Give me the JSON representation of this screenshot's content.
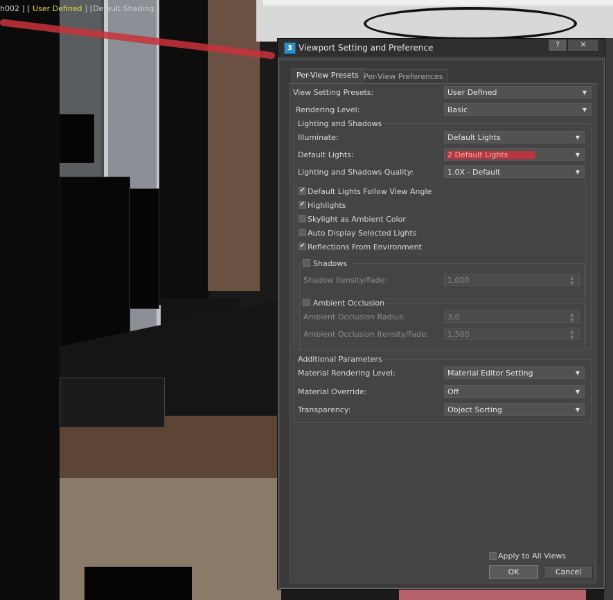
{
  "viewport": {
    "label_prefix": "h002 ] [ ",
    "label_highlight": "User Defined",
    "label_suffix": " ] [Default Shading ]"
  },
  "dialog": {
    "app_icon": "3",
    "title": "Viewport Setting and Preference",
    "help_button": "?",
    "close_button": "✕",
    "tabs": [
      "Per-View Presets",
      "Per-View Preferences"
    ],
    "view_setting_presets": {
      "label": "View Setting Presets:",
      "value": "User Defined"
    },
    "rendering_level": {
      "label": "Rendering Level:",
      "value": "Basic"
    },
    "lighting_group": {
      "title": "Lighting and Shadows",
      "illuminate": {
        "label": "Illuminate:",
        "value": "Default Lights"
      },
      "default_lights": {
        "label": "Default Lights:",
        "value": "2 Default Lights"
      },
      "quality": {
        "label": "Lighting and Shadows Quality:",
        "value": "1.0X - Default"
      },
      "checkboxes": [
        {
          "label": "Default Lights Follow View Angle",
          "checked": true
        },
        {
          "label": "Highlights",
          "checked": true
        },
        {
          "label": "Skylight as Ambient Color",
          "checked": false
        },
        {
          "label": "Auto Display Selected Lights",
          "checked": false
        },
        {
          "label": "Reflections From Environment",
          "checked": true
        }
      ],
      "shadows": {
        "title": "Shadows",
        "intensity": {
          "label": "Shadow Itensity/Fade:",
          "value": "1,000"
        }
      },
      "ambient_occlusion": {
        "title": "Ambient Occlusion",
        "radius": {
          "label": "Ambient Occlusion Radius:",
          "value": "3,0"
        },
        "intensity": {
          "label": "Ambient Occlusion Itensity/Fade:",
          "value": "1,500"
        }
      }
    },
    "additional_group": {
      "title": "Additional Parameters",
      "material_rendering_level": {
        "label": "Material Rendering Level:",
        "value": "Material Editor Setting"
      },
      "material_override": {
        "label": "Material Override:",
        "value": "Off"
      },
      "transparency": {
        "label": "Transparency:",
        "value": "Object Sorting"
      }
    },
    "apply_all_views": "Apply to All Views",
    "ok": "OK",
    "cancel": "Cancel"
  },
  "icons": {
    "dropdown": "▼",
    "spinner": "▲▼",
    "check": "✔"
  },
  "colors": {
    "dialog_bg": "#444444",
    "annotation_red": "#c8323c",
    "viewport_highlight": "#e9d44a"
  }
}
